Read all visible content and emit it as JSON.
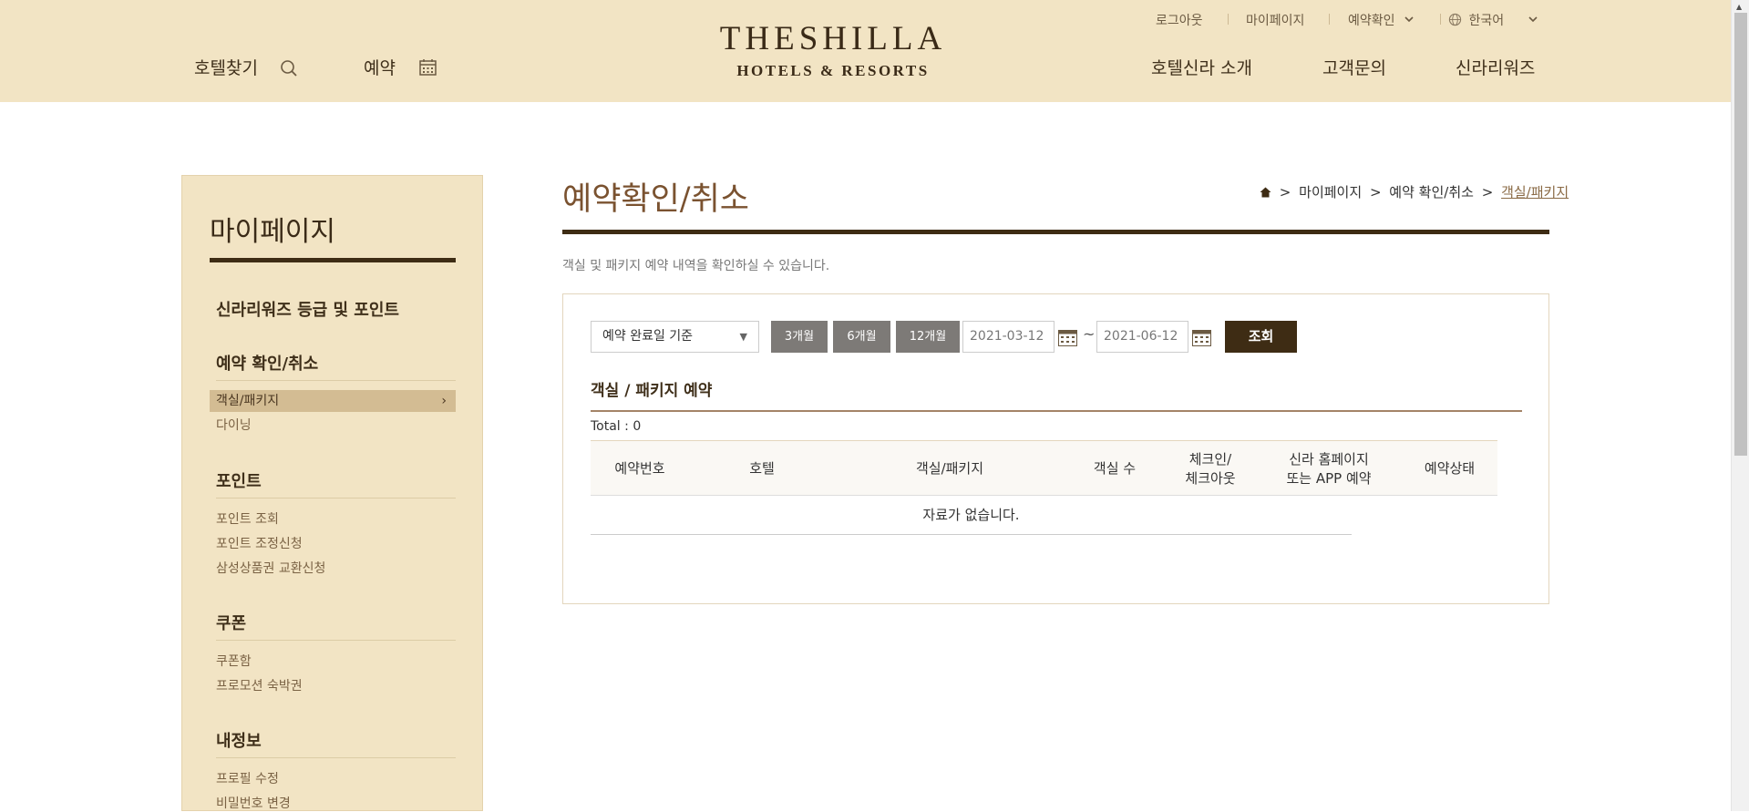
{
  "header": {
    "util": {
      "logout": "로그아웃",
      "mypage": "마이페이지",
      "reservation_check": "예약확인",
      "language": "한국어"
    },
    "find_hotel": "호텔찾기",
    "reserve": "예약",
    "logo_line1": "THESHILLA",
    "logo_line2": "HOTELS & RESORTS",
    "nav": {
      "about": "호텔신라 소개",
      "inquiry": "고객문의",
      "rewards": "신라리워즈"
    }
  },
  "sidebar": {
    "title": "마이페이지",
    "sections": {
      "rewards_grade": "신라리워즈 등급 및 포인트",
      "reservation": {
        "heading": "예약 확인/취소",
        "items": [
          "객실/패키지",
          "다이닝"
        ]
      },
      "point": {
        "heading": "포인트",
        "items": [
          "포인트 조회",
          "포인트 조정신청",
          "삼성상품권 교환신청"
        ]
      },
      "coupon": {
        "heading": "쿠폰",
        "items": [
          "쿠폰함",
          "프로모션 숙박권"
        ]
      },
      "myinfo": {
        "heading": "내정보",
        "items": [
          "프로필 수정",
          "비밀번호 변경"
        ]
      }
    }
  },
  "content": {
    "title": "예약확인/취소",
    "breadcrumb": [
      "마이페이지",
      "예약 확인/취소",
      "객실/패키지"
    ],
    "breadcrumb_sep": ">",
    "description": "객실 및 패키지 예약 내역을 확인하실 수 있습니다.",
    "filter": {
      "select_value": "예약 완료일 기준",
      "periods": [
        "3개월",
        "6개월",
        "12개월"
      ],
      "date_from": "2021-03-12",
      "tilde": "~",
      "date_to": "2021-06-12",
      "search_label": "조회"
    },
    "section_title": "객실 / 패키지 예약",
    "total": "Total : 0",
    "table": {
      "headers": [
        "예약번호",
        "호텔",
        "객실/패키지",
        "객실 수",
        "체크인/",
        "체크아웃",
        "신라 홈페이지",
        "또는 APP 예약",
        "예약상태"
      ],
      "empty_message": "자료가 없습니다."
    }
  },
  "colors": {
    "header_bg": "#f2e4c4",
    "dark_brown": "#3e2c14",
    "accent_brown": "#7a5230"
  }
}
